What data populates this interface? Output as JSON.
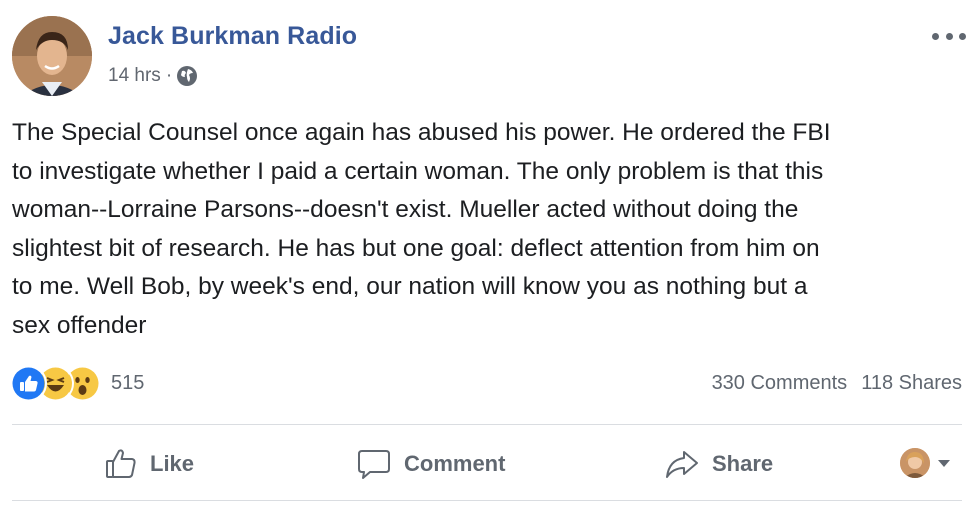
{
  "post": {
    "author": "Jack Burkman Radio",
    "time": "14 hrs",
    "separator": "·",
    "privacy_icon": "globe-icon",
    "body": "The Special Counsel once again has abused his power. He ordered the FBI\nto investigate whether I paid a certain woman. The only problem is that this\nwoman--Lorraine Parsons--doesn't exist. Mueller acted without doing the\nslightest bit of research. He has but one goal: deflect attention from him on\nto me. Well Bob, by week's end, our nation will know you as nothing but a\nsex offender"
  },
  "reactions": {
    "icons": [
      "like-icon",
      "haha-icon",
      "wow-icon"
    ],
    "count": "515"
  },
  "stats": {
    "comments": "330 Comments",
    "shares": "118 Shares"
  },
  "actions": {
    "like": "Like",
    "comment": "Comment",
    "share": "Share"
  },
  "colors": {
    "author": "#385898",
    "text": "#1c1e21",
    "secondary": "#606770",
    "like_blue": "#2078f4",
    "emoji_yellow": "#f7c844"
  }
}
